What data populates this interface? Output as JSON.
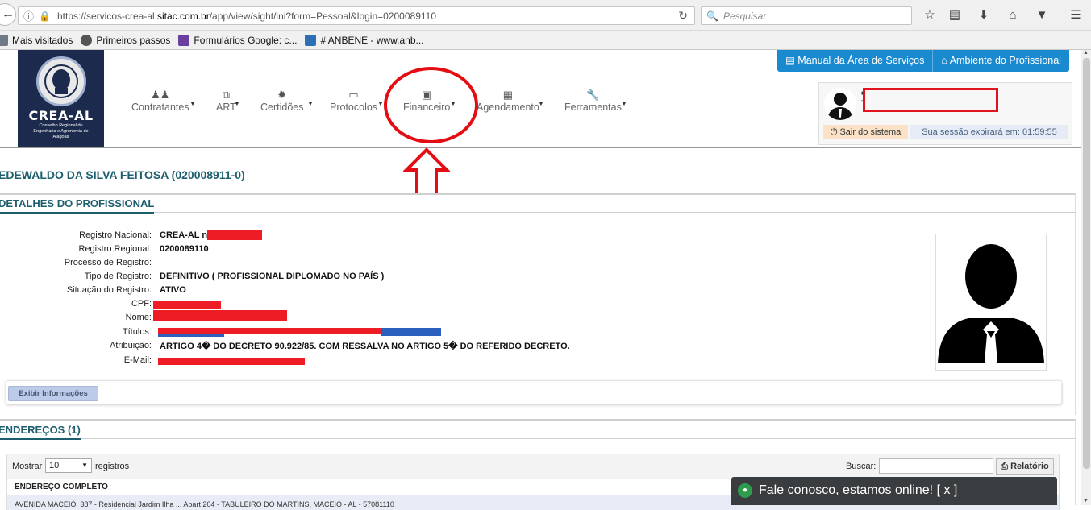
{
  "browser": {
    "url_prefix": "https://servicos-crea-al.",
    "url_domain": "sitac.com.br",
    "url_suffix": "/app/view/sight/ini?form=Pessoal&login=0200089110",
    "search_placeholder": "Pesquisar",
    "bookmarks": [
      {
        "label": "Mais visitados",
        "color": "#6f7a86"
      },
      {
        "label": "Primeiros passos",
        "color": "#555555"
      },
      {
        "label": "Formulários Google: c...",
        "color": "#6b3fa0"
      },
      {
        "label": "# ANBENE - www.anb...",
        "color": "#2d6fb5"
      }
    ]
  },
  "logo": {
    "name": "CREA-AL",
    "subtitle": "Conselho Regional de Engenharia e Agronomia de Alagoas"
  },
  "nav": [
    {
      "label": "Contratantes",
      "icon": "users-icon"
    },
    {
      "label": "ART",
      "icon": "documents-icon"
    },
    {
      "label": "Certidões",
      "icon": "seal-icon"
    },
    {
      "label": "Protocolos",
      "icon": "inbox-icon"
    },
    {
      "label": "Financeiro",
      "icon": "money-icon"
    },
    {
      "label": "Agendamento",
      "icon": "calendar-icon"
    },
    {
      "label": "Ferramentas",
      "icon": "wrench-icon"
    }
  ],
  "top_buttons": {
    "manual": "Manual da Área de Serviços",
    "ambiente": "Ambiente do Profissional"
  },
  "user_box": {
    "logout": "Sair do sistema",
    "session": "Sua sessão expirará em: 01:59:55"
  },
  "professional": {
    "title": "EDEWALDO DA SILVA FEITOSA (020008911-0)",
    "section_title": "DETALHES DO PROFISSIONAL",
    "fields": [
      {
        "label": "Registro Nacional:",
        "value": "CREA-AL nº"
      },
      {
        "label": "Registro Regional:",
        "value": "0200089110"
      },
      {
        "label": "Processo de Registro:",
        "value": ""
      },
      {
        "label": "Tipo de Registro:",
        "value": "DEFINITIVO ( PROFISSIONAL DIPLOMADO NO PAÍS )"
      },
      {
        "label": "Situação do Registro:",
        "value": "ATIVO"
      },
      {
        "label": "CPF:",
        "value": ""
      },
      {
        "label": "Nome:",
        "value": ""
      },
      {
        "label": "Títulos:",
        "value": ""
      },
      {
        "label": "Atribuição:",
        "value": "ARTIGO 4� DO DECRETO 90.922/85. COM RESSALVA NO ARTIGO 5� DO REFERIDO DECRETO."
      },
      {
        "label": "E-Mail:",
        "value": ""
      }
    ],
    "show_info_button": "Exibir Informações"
  },
  "addresses": {
    "section_title": "ENDEREÇOS (1)",
    "show_label": "Mostrar",
    "page_size": "10",
    "records_label": "registros",
    "search_label": "Buscar:",
    "report_button": "Relatório",
    "column_header": "ENDEREÇO COMPLETO",
    "rows": [
      "AVENIDA MACEIÓ, 387 - Residencial Jardim Ilha ... Apart 204 - TABULEIRO DO MARTINS, MACEIÓ - AL - 57081110"
    ]
  },
  "chat": {
    "label": "Fale conosco, estamos online! [ x ]"
  }
}
